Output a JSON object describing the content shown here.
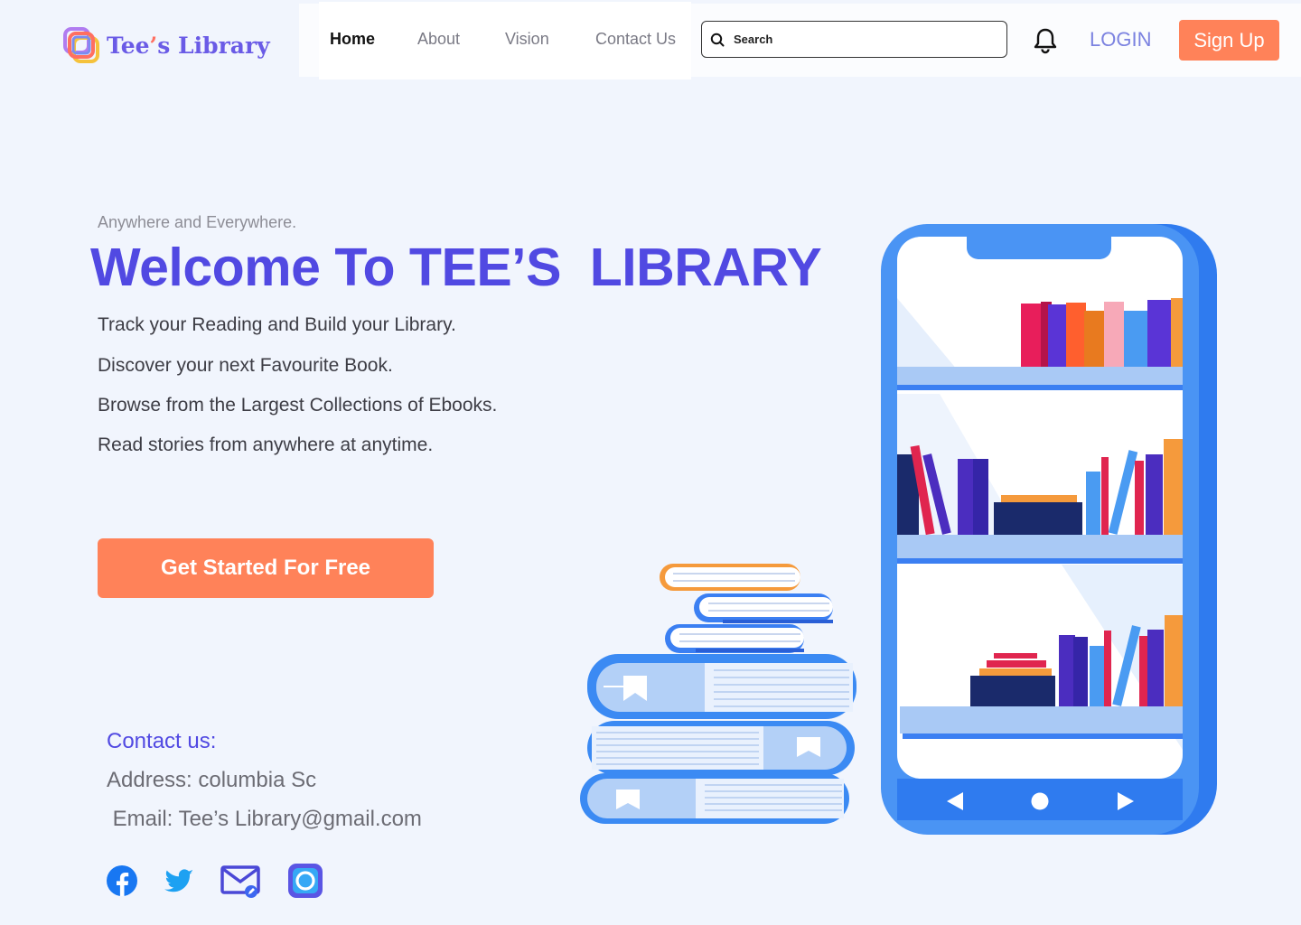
{
  "brand": {
    "name_pre": "Tee",
    "name_apos": "’",
    "name_post": "s Library"
  },
  "nav": {
    "items": [
      {
        "label": "Home",
        "active": true
      },
      {
        "label": "About",
        "active": false
      },
      {
        "label": "Vision",
        "active": false
      },
      {
        "label": "Contact Us",
        "active": false
      }
    ]
  },
  "search": {
    "placeholder": "Search",
    "icon": "search-icon"
  },
  "notifications": {
    "icon": "bell-icon"
  },
  "auth": {
    "login_label": "LOGIN",
    "signup_label": "Sign Up"
  },
  "hero": {
    "tagline": "Anywhere and Everywhere.",
    "headline": "Welcome To TEE’S  LIBRARY",
    "features": [
      "Track your Reading and Build your Library.",
      "Discover your next Favourite Book.",
      "Browse from the Largest Collections of Ebooks.",
      "Read stories from anywhere at anytime."
    ],
    "cta_label": "Get Started For Free"
  },
  "contact": {
    "title": "Contact us:",
    "address": "Address: columbia Sc",
    "email": " Email: Tee’s Library@gmail.com"
  },
  "social": [
    {
      "icon": "facebook-icon"
    },
    {
      "icon": "twitter-icon"
    },
    {
      "icon": "email-icon"
    },
    {
      "icon": "instagram-icon"
    }
  ],
  "colors": {
    "background": "#f1f5fd",
    "brand_purple": "#5149e2",
    "accent_orange": "#ff8259",
    "phone_blue": "#4a90f2",
    "login_blue": "#7b82e0"
  }
}
